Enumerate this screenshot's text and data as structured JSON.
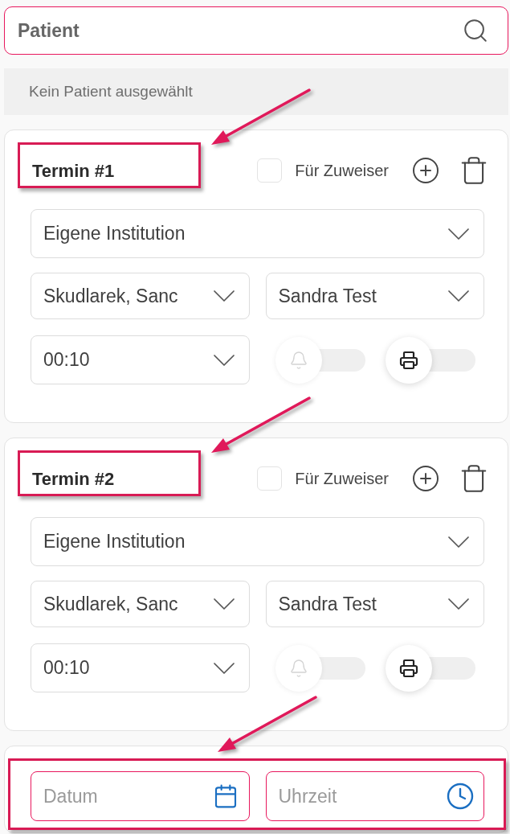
{
  "search": {
    "placeholder": "Patient"
  },
  "patient_status": "Kein Patient ausgewählt",
  "appointments": [
    {
      "title": "Termin #1",
      "highlighted": true,
      "referrer": {
        "label": "Für Zuweiser",
        "checked": false
      },
      "institution": "Eigene Institution",
      "practitioner": "Skudlarek, Sanc",
      "resource": "Sandra Test",
      "duration": "00:10",
      "toggles": [
        {
          "kind": "bell",
          "on": false,
          "disabled": true
        },
        {
          "kind": "printer",
          "on": false,
          "disabled": false
        }
      ]
    },
    {
      "title": "Termin #2",
      "highlighted": true,
      "referrer": {
        "label": "Für Zuweiser",
        "checked": false
      },
      "institution": "Eigene Institution",
      "practitioner": "Skudlarek, Sanc",
      "resource": "Sandra Test",
      "duration": "00:10",
      "toggles": [
        {
          "kind": "bell",
          "on": false,
          "disabled": true
        },
        {
          "kind": "printer",
          "on": false,
          "disabled": false
        }
      ]
    }
  ],
  "schedule": {
    "highlighted": true,
    "fields": [
      {
        "kind": "date",
        "placeholder": "Datum"
      },
      {
        "kind": "time",
        "placeholder": "Uhrzeit"
      }
    ]
  }
}
